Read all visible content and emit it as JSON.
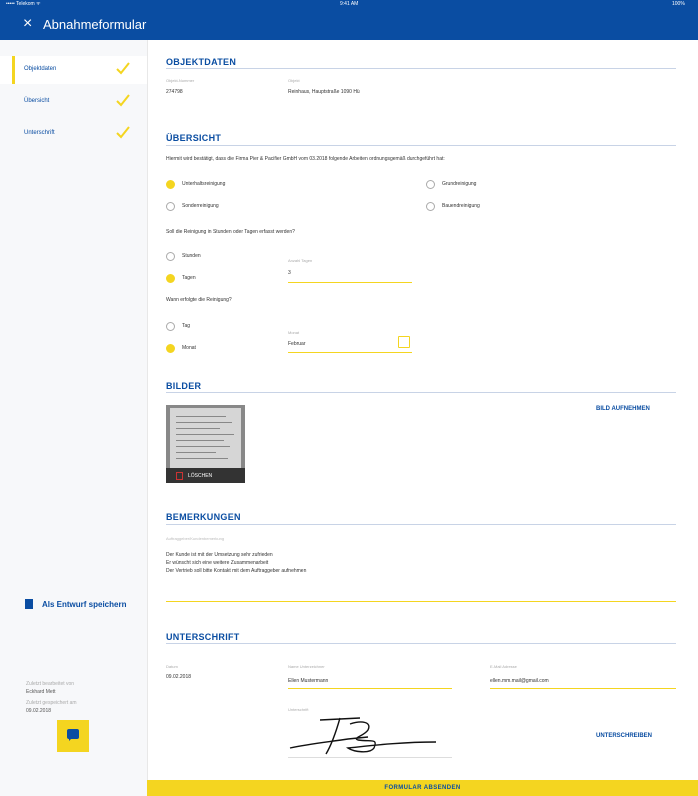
{
  "statusbar": {
    "carrier": "••••• Telekom ᯤ",
    "time": "9:41 AM",
    "battery": "100%"
  },
  "header": {
    "close_icon": "close-icon",
    "title": "Abnahmeformular"
  },
  "sidebar": {
    "items": [
      {
        "label": "Objektdaten",
        "done": true
      },
      {
        "label": "Übersicht",
        "done": true
      },
      {
        "label": "Unterschrift",
        "done": true
      }
    ],
    "draft_button": "Als Entwurf speichern",
    "last_saved_label": "Zuletzt bearbeitet von",
    "last_saved_value": "Eckhard Mett",
    "date_label": "Zuletzt gespeichert am",
    "date_value": "09.02.2018",
    "chat_icon": "chat-icon"
  },
  "objektdaten": {
    "title": "OBJEKTDATEN",
    "nummer_label": "Objekt-Nummer",
    "nummer_value": "274798",
    "objekt_label": "Objekt",
    "objekt_value": "Reinhaus, Hauptstraße 1090 Hü"
  },
  "uebersicht": {
    "title": "ÜBERSICHT",
    "intro": "Hiermit wird bestätigt, dass die Firma Pier & Pacifier GmbH vom 03.2018 folgende Arbeiten ordnungsgemäß durchgeführt hat:",
    "options": [
      {
        "label": "Unterhaltsreinigung",
        "selected": true
      },
      {
        "label": "Grundreinigung",
        "selected": false
      },
      {
        "label": "Sonderreinigung",
        "selected": false
      },
      {
        "label": "Bauendreinigung",
        "selected": false
      }
    ],
    "question1": "Soll die Reinigung in Stunden oder Tagen erfasst werden?",
    "unit_options": [
      {
        "label": "Stunden",
        "selected": false
      },
      {
        "label": "Tagen",
        "selected": true
      }
    ],
    "amount_label": "Anzahl Tagen",
    "amount_value": "3",
    "question2": "Wann erfolgte die Reinigung?",
    "period_options": [
      {
        "label": "Tag",
        "selected": false
      },
      {
        "label": "Monat",
        "selected": true
      }
    ],
    "month_label": "Monat",
    "month_value": "Februar"
  },
  "bilder": {
    "title": "BILDER",
    "delete_label": "LÖSCHEN",
    "capture_label": "BILD AUFNEHMEN"
  },
  "bemerkungen": {
    "title": "BEMERKUNGEN",
    "placeholder": "Auftraggeber/Kundenbemerkung",
    "lines": [
      "Der Kunde ist mit der Umsetzung sehr zufrieden",
      "Er wünscht sich eine weitere Zusammenarbeit",
      "Der Vertrieb soll bitte Kontakt mit dem Auftraggeber aufnehmen"
    ]
  },
  "unterschrift": {
    "title": "UNTERSCHRIFT",
    "date_label": "Datum",
    "date_value": "09.02.2018",
    "name_label": "Name Unterzeichner",
    "name_value": "Ellen Mustermann",
    "email_label": "E-Mail Adresse",
    "email_value": "ellen.mm.mail@gmail.com",
    "sig_label": "Unterschrift",
    "sign_button": "UNTERSCHREIBEN"
  },
  "submit_label": "FORMULAR ABSENDEN",
  "colors": {
    "primary": "#0a4da2",
    "accent": "#f4d520"
  }
}
